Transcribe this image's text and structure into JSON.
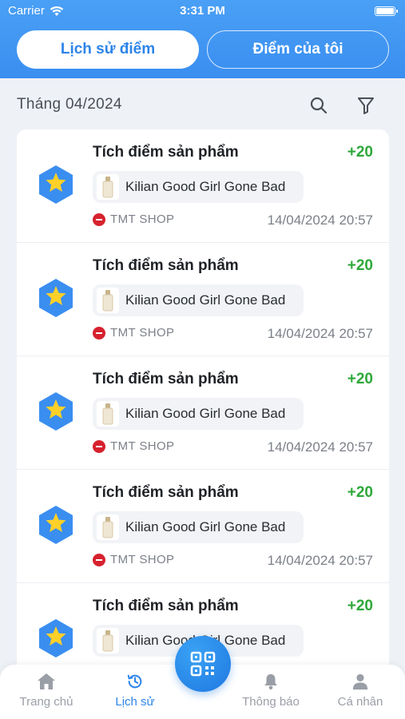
{
  "status_bar": {
    "carrier": "Carrier",
    "time": "3:31 PM"
  },
  "tabs": [
    {
      "label": "Lịch sử điểm",
      "active": true
    },
    {
      "label": "Điểm của tôi",
      "active": false
    }
  ],
  "month": "Tháng 04/2024",
  "icons": {
    "search": "search-icon",
    "filter": "filter-icon"
  },
  "items": [
    {
      "title": "Tích điểm sản phẩm",
      "points": "+20",
      "product": "Kilian Good Girl Gone Bad",
      "shop": "TMT SHOP",
      "date": "14/04/2024 20:57"
    },
    {
      "title": "Tích điểm sản phẩm",
      "points": "+20",
      "product": "Kilian Good Girl Gone Bad",
      "shop": "TMT SHOP",
      "date": "14/04/2024 20:57"
    },
    {
      "title": "Tích điểm sản phẩm",
      "points": "+20",
      "product": "Kilian Good Girl Gone Bad",
      "shop": "TMT SHOP",
      "date": "14/04/2024 20:57"
    },
    {
      "title": "Tích điểm sản phẩm",
      "points": "+20",
      "product": "Kilian Good Girl Gone Bad",
      "shop": "TMT SHOP",
      "date": "14/04/2024 20:57"
    },
    {
      "title": "Tích điểm sản phẩm",
      "points": "+20",
      "product": "Kilian Good Girl Gone Bad",
      "shop": "",
      "date": ""
    }
  ],
  "nav": [
    {
      "label": "Trang chủ",
      "icon": "home-icon",
      "active": false
    },
    {
      "label": "Lịch sử",
      "icon": "history-icon",
      "active": true
    },
    {
      "label": "Thông báo",
      "icon": "bell-icon",
      "active": false
    },
    {
      "label": "Cá nhân",
      "icon": "user-icon",
      "active": false
    }
  ],
  "colors": {
    "primary": "#2d84ea",
    "points": "#2ea83a",
    "shop": "#d6222e"
  }
}
